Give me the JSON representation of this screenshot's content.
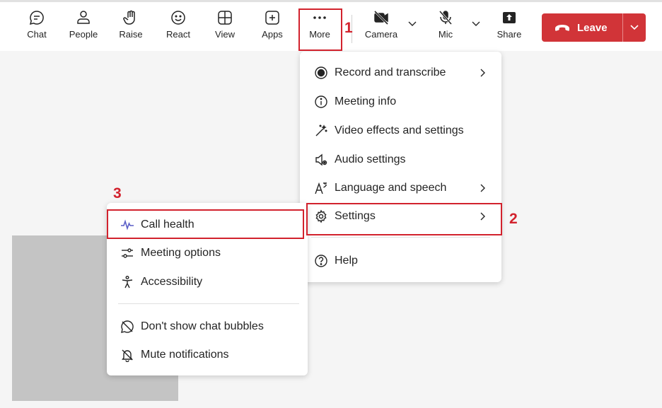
{
  "toolbar": {
    "chat": "Chat",
    "people": "People",
    "raise": "Raise",
    "react": "React",
    "view": "View",
    "apps": "Apps",
    "more": "More",
    "camera": "Camera",
    "mic": "Mic",
    "share": "Share",
    "leave": "Leave"
  },
  "more_menu": {
    "items": [
      {
        "label": "Record and transcribe",
        "icon": "record-icon",
        "submenu": true
      },
      {
        "label": "Meeting info",
        "icon": "info-icon",
        "submenu": false
      },
      {
        "label": "Video effects and settings",
        "icon": "video-effects-icon",
        "submenu": false
      },
      {
        "label": "Audio settings",
        "icon": "audio-settings-icon",
        "submenu": false
      },
      {
        "label": "Language and speech",
        "icon": "language-icon",
        "submenu": true
      },
      {
        "label": "Settings",
        "icon": "gear-icon",
        "submenu": true
      },
      {
        "label": "Help",
        "icon": "help-icon",
        "submenu": false
      }
    ]
  },
  "settings_menu": {
    "items": [
      {
        "label": "Call health",
        "icon": "call-health-icon"
      },
      {
        "label": "Meeting options",
        "icon": "meeting-options-icon"
      },
      {
        "label": "Accessibility",
        "icon": "accessibility-icon"
      },
      {
        "label": "Don't show chat bubbles",
        "icon": "chat-bubbles-off-icon"
      },
      {
        "label": "Mute notifications",
        "icon": "bell-off-icon"
      }
    ]
  },
  "annotations": {
    "step1": "1",
    "step2": "2",
    "step3": "3"
  },
  "colors": {
    "leave": "#d13438",
    "annotation": "#d2222d",
    "accent": "#5b5fc7"
  }
}
